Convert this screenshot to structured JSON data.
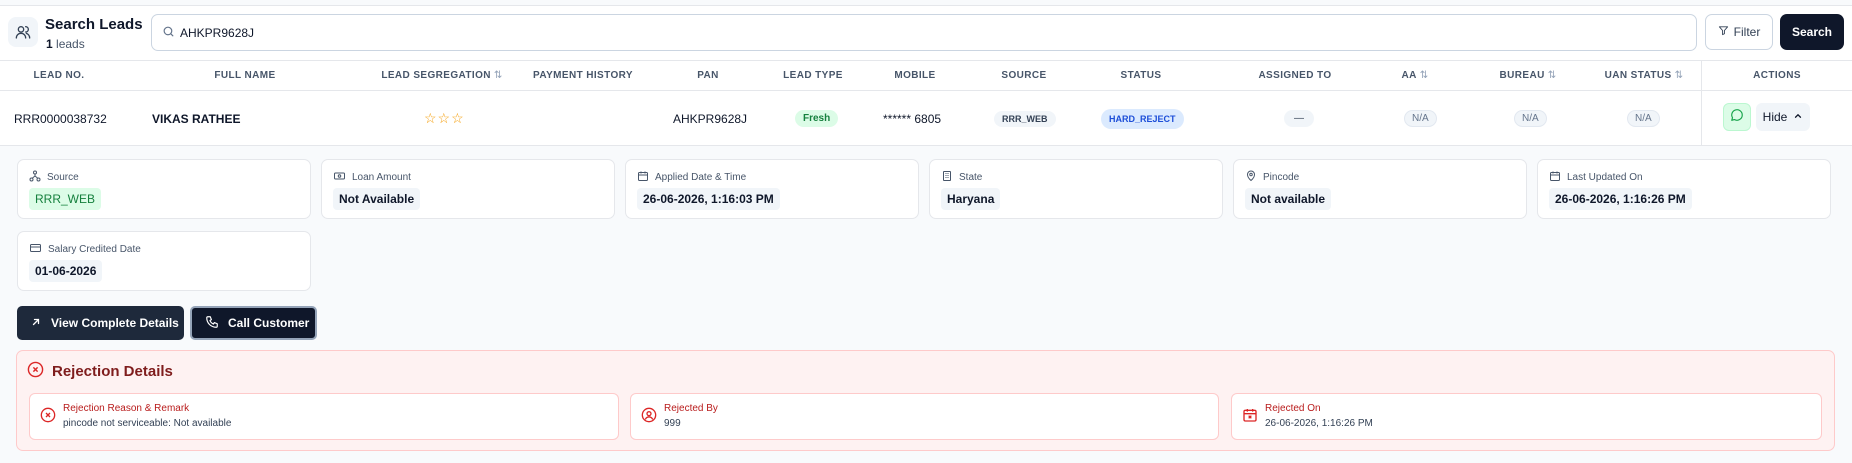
{
  "header": {
    "title": "Search Leads",
    "count": "1",
    "count_suffix": "leads",
    "search_value": "AHKPR9628J",
    "filter_label": "Filter",
    "search_label": "Search"
  },
  "table": {
    "columns": [
      "LEAD NO.",
      "FULL NAME",
      "LEAD SEGREGATION",
      "PAYMENT HISTORY",
      "PAN",
      "LEAD TYPE",
      "MOBILE",
      "SOURCE",
      "STATUS",
      "ASSIGNED TO",
      "AA",
      "BUREAU",
      "UAN STATUS",
      "ACTIONS"
    ],
    "sort_icon": "⇅",
    "row": {
      "lead_no": "RRR0000038732",
      "full_name": "VIKAS RATHEE",
      "stars": "☆☆☆",
      "pan": "AHKPR9628J",
      "lead_type": "Fresh",
      "mobile": "****** 6805",
      "source": "RRR_WEB",
      "status": "HARD_REJECT",
      "assigned_to": "—",
      "aa": "N/A",
      "bureau": "N/A",
      "uan_status": "N/A",
      "hide_label": "Hide"
    }
  },
  "details": {
    "cards": [
      {
        "label": "Source",
        "value": "RRR_WEB"
      },
      {
        "label": "Loan Amount",
        "value": "Not Available"
      },
      {
        "label": "Applied Date & Time",
        "value": "26-06-2026, 1:16:03 PM"
      },
      {
        "label": "State",
        "value": "Haryana"
      },
      {
        "label": "Pincode",
        "value": "Not available"
      },
      {
        "label": "Last Updated On",
        "value": "26-06-2026, 1:16:26 PM"
      },
      {
        "label": "Salary Credited Date",
        "value": "01-06-2026"
      }
    ],
    "view_details_label": "View Complete Details",
    "call_customer_label": "Call Customer"
  },
  "rejection": {
    "title": "Rejection Details",
    "items": [
      {
        "label": "Rejection Reason & Remark",
        "value": "pincode not serviceable: Not available"
      },
      {
        "label": "Rejected By",
        "value": "999"
      },
      {
        "label": "Rejected On",
        "value": "26-06-2026, 1:16:26 PM"
      }
    ]
  },
  "colors": {
    "primary": "#0f172a",
    "success_bg": "#dcfce7",
    "danger_bg": "#fef2f2",
    "danger_text": "#b91c1c"
  }
}
